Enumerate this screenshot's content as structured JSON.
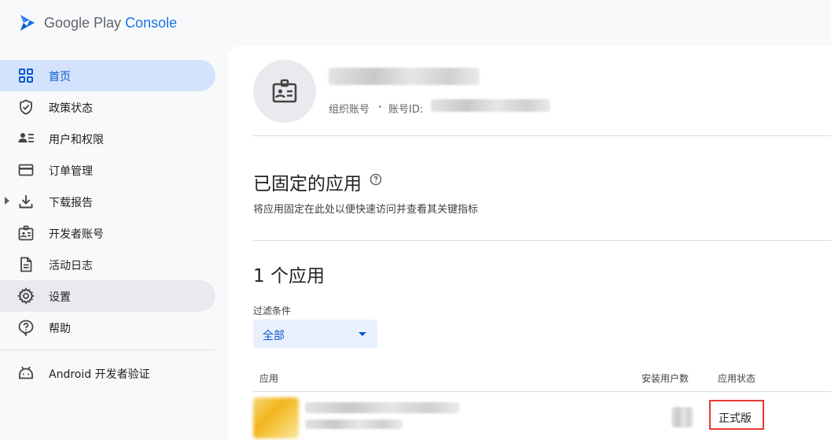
{
  "app": {
    "logo_google_play": "Google Play ",
    "logo_console": "Console"
  },
  "sidebar": {
    "items": [
      {
        "label": "首页",
        "icon": "dashboard-grid-icon",
        "state": "active"
      },
      {
        "label": "政策状态",
        "icon": "shield-check-icon",
        "state": "normal"
      },
      {
        "label": "用户和权限",
        "icon": "manage-users-icon",
        "state": "normal"
      },
      {
        "label": "订单管理",
        "icon": "credit-card-icon",
        "state": "normal"
      },
      {
        "label": "下载报告",
        "icon": "download-icon",
        "state": "normal",
        "expandable": true
      },
      {
        "label": "开发者账号",
        "icon": "id-badge-icon",
        "state": "normal"
      },
      {
        "label": "活动日志",
        "icon": "document-icon",
        "state": "normal"
      },
      {
        "label": "设置",
        "icon": "gear-icon",
        "state": "hover"
      },
      {
        "label": "帮助",
        "icon": "help-bubble-icon",
        "state": "normal"
      },
      {
        "label": "Android 开发者验证",
        "icon": "android-icon",
        "state": "normal"
      }
    ]
  },
  "account": {
    "type": "组织账号",
    "id_label": "账号ID:"
  },
  "pinned": {
    "title": "已固定的应用",
    "subtitle": "将应用固定在此处以便快速访问并查看其关键指标"
  },
  "apps": {
    "count_title": "1 个应用",
    "filter_label": "过滤条件",
    "filter_value": "全部",
    "columns": {
      "app": "应用",
      "installs": "安装用户数",
      "status": "应用状态"
    },
    "rows": [
      {
        "status": "正式版"
      }
    ]
  },
  "colors": {
    "accent": "#0b57d0",
    "active_bg": "#d3e3fd",
    "highlight": "#e53935"
  }
}
